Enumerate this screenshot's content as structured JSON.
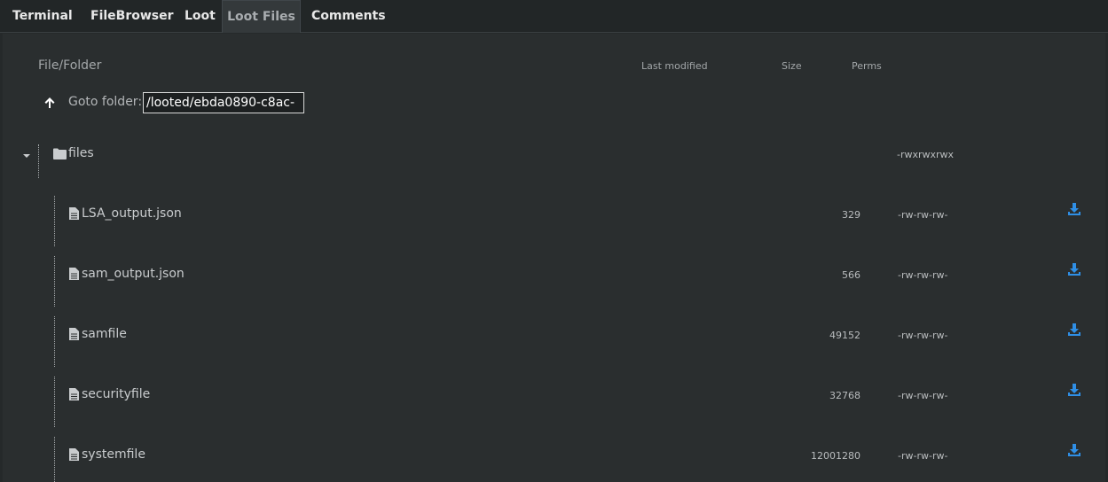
{
  "tabs": [
    {
      "label": "Terminal",
      "active": false
    },
    {
      "label": "FileBrowser",
      "active": false
    },
    {
      "label": "Loot",
      "active": false
    },
    {
      "label": "Loot Files",
      "active": true
    },
    {
      "label": "Comments",
      "active": false
    }
  ],
  "columns": {
    "name": "File/Folder",
    "modified": "Last modified",
    "size": "Size",
    "perms": "Perms"
  },
  "goto": {
    "label": "Goto folder:",
    "value": "/looted/ebda0890-c8ac-"
  },
  "folder": {
    "name": "files",
    "perms": "-rwxrwxrwx",
    "icon": "folder-icon",
    "expanded": true
  },
  "files": [
    {
      "name": "LSA_output.json",
      "size": "329",
      "perms": "-rw-rw-rw-"
    },
    {
      "name": "sam_output.json",
      "size": "566",
      "perms": "-rw-rw-rw-"
    },
    {
      "name": "samfile",
      "size": "49152",
      "perms": "-rw-rw-rw-"
    },
    {
      "name": "securityfile",
      "size": "32768",
      "perms": "-rw-rw-rw-"
    },
    {
      "name": "systemfile",
      "size": "12001280",
      "perms": "-rw-rw-rw-"
    }
  ],
  "colors": {
    "accent": "#2f8fe6",
    "background": "#2a2e2f",
    "tabbar": "#222627"
  }
}
